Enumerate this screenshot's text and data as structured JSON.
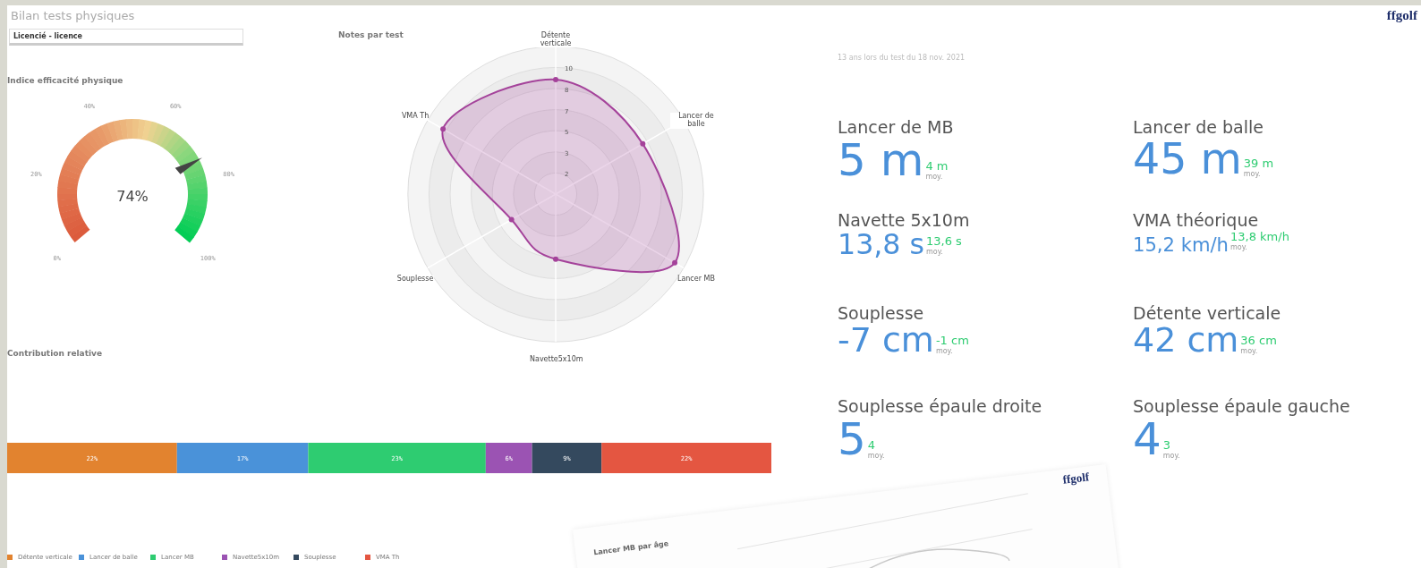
{
  "title": "Bilan tests physiques",
  "logo": "ffgolf",
  "filter": {
    "value": "Licencié - licence"
  },
  "gauge": {
    "title": "Indice efficacité physique",
    "level": 0.74,
    "reading": "74%",
    "ticks": [
      "0%",
      "20%",
      "40%",
      "60%",
      "80%",
      "100%"
    ]
  },
  "radar": {
    "title": "Notes par test",
    "axis_labels": [
      "Détente verticale",
      "Lancer de balle",
      "Lancer MB",
      "Navette5x10m",
      "Souplesse",
      "VMA Th"
    ],
    "ring_labels": [
      "10",
      "8",
      "7",
      "5",
      "3",
      "2"
    ]
  },
  "contribution": {
    "title": "Contribution relative",
    "segments": [
      {
        "name": "Détente verticale",
        "color": "#e2832f",
        "share": "22%"
      },
      {
        "name": "Lancer de balle",
        "color": "#4a92d9",
        "share": "17%"
      },
      {
        "name": "Lancer MB",
        "color": "#2ecc71",
        "share": "23%"
      },
      {
        "name": "Navette5x10m",
        "color": "#9b53b3",
        "share": "6%"
      },
      {
        "name": "Souplesse",
        "color": "#34495e",
        "share": "9%"
      },
      {
        "name": "VMA Th",
        "color": "#e45641",
        "share": "22%"
      }
    ]
  },
  "test_info": "13 ans lors du test du 18 nov. 2021",
  "kpis": [
    {
      "label": "Lancer de MB",
      "value": "5 m",
      "average": "4 m",
      "average_label": "moy."
    },
    {
      "label": "Lancer de balle",
      "value": "45 m",
      "average": "39 m",
      "average_label": "moy."
    },
    {
      "label": "Navette 5x10m",
      "value": "13,8 s",
      "average": "13,6 s",
      "average_label": "moy."
    },
    {
      "label": "VMA théorique",
      "value": "15,2 km/h",
      "average": "13,8 km/h",
      "average_label": "moy."
    },
    {
      "label": "Souplesse",
      "value": "-7 cm",
      "average": "-1 cm",
      "average_label": "moy."
    },
    {
      "label": "Détente verticale",
      "value": "42 cm",
      "average": "36 cm",
      "average_label": "moy."
    },
    {
      "label": "Souplesse épaule droite",
      "value": "5",
      "average": "4",
      "average_label": "moy."
    },
    {
      "label": "Souplesse épaule gauche",
      "value": "4",
      "average": "3",
      "average_label": "moy."
    }
  ],
  "overlay_sheet": {
    "logo": "ffgolf",
    "chart_title": "Lancer MB par âge"
  }
}
